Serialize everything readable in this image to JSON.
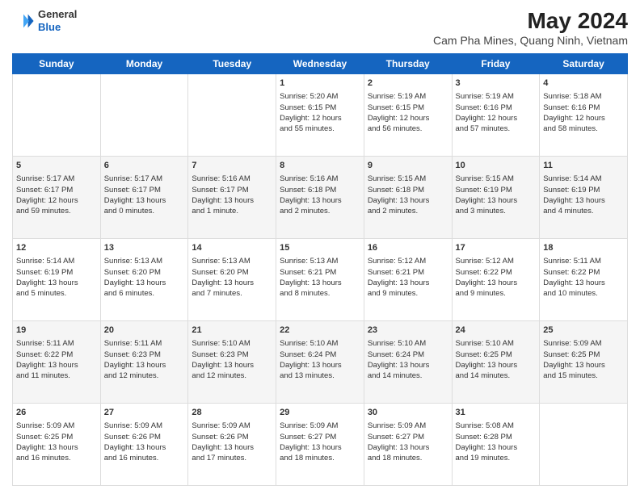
{
  "header": {
    "logo_line1": "General",
    "logo_line2": "Blue",
    "title": "May 2024",
    "subtitle": "Cam Pha Mines, Quang Ninh, Vietnam"
  },
  "weekdays": [
    "Sunday",
    "Monday",
    "Tuesday",
    "Wednesday",
    "Thursday",
    "Friday",
    "Saturday"
  ],
  "weeks": [
    [
      {
        "day": "",
        "info": ""
      },
      {
        "day": "",
        "info": ""
      },
      {
        "day": "",
        "info": ""
      },
      {
        "day": "1",
        "info": "Sunrise: 5:20 AM\nSunset: 6:15 PM\nDaylight: 12 hours\nand 55 minutes."
      },
      {
        "day": "2",
        "info": "Sunrise: 5:19 AM\nSunset: 6:15 PM\nDaylight: 12 hours\nand 56 minutes."
      },
      {
        "day": "3",
        "info": "Sunrise: 5:19 AM\nSunset: 6:16 PM\nDaylight: 12 hours\nand 57 minutes."
      },
      {
        "day": "4",
        "info": "Sunrise: 5:18 AM\nSunset: 6:16 PM\nDaylight: 12 hours\nand 58 minutes."
      }
    ],
    [
      {
        "day": "5",
        "info": "Sunrise: 5:17 AM\nSunset: 6:17 PM\nDaylight: 12 hours\nand 59 minutes."
      },
      {
        "day": "6",
        "info": "Sunrise: 5:17 AM\nSunset: 6:17 PM\nDaylight: 13 hours\nand 0 minutes."
      },
      {
        "day": "7",
        "info": "Sunrise: 5:16 AM\nSunset: 6:17 PM\nDaylight: 13 hours\nand 1 minute."
      },
      {
        "day": "8",
        "info": "Sunrise: 5:16 AM\nSunset: 6:18 PM\nDaylight: 13 hours\nand 2 minutes."
      },
      {
        "day": "9",
        "info": "Sunrise: 5:15 AM\nSunset: 6:18 PM\nDaylight: 13 hours\nand 2 minutes."
      },
      {
        "day": "10",
        "info": "Sunrise: 5:15 AM\nSunset: 6:19 PM\nDaylight: 13 hours\nand 3 minutes."
      },
      {
        "day": "11",
        "info": "Sunrise: 5:14 AM\nSunset: 6:19 PM\nDaylight: 13 hours\nand 4 minutes."
      }
    ],
    [
      {
        "day": "12",
        "info": "Sunrise: 5:14 AM\nSunset: 6:19 PM\nDaylight: 13 hours\nand 5 minutes."
      },
      {
        "day": "13",
        "info": "Sunrise: 5:13 AM\nSunset: 6:20 PM\nDaylight: 13 hours\nand 6 minutes."
      },
      {
        "day": "14",
        "info": "Sunrise: 5:13 AM\nSunset: 6:20 PM\nDaylight: 13 hours\nand 7 minutes."
      },
      {
        "day": "15",
        "info": "Sunrise: 5:13 AM\nSunset: 6:21 PM\nDaylight: 13 hours\nand 8 minutes."
      },
      {
        "day": "16",
        "info": "Sunrise: 5:12 AM\nSunset: 6:21 PM\nDaylight: 13 hours\nand 9 minutes."
      },
      {
        "day": "17",
        "info": "Sunrise: 5:12 AM\nSunset: 6:22 PM\nDaylight: 13 hours\nand 9 minutes."
      },
      {
        "day": "18",
        "info": "Sunrise: 5:11 AM\nSunset: 6:22 PM\nDaylight: 13 hours\nand 10 minutes."
      }
    ],
    [
      {
        "day": "19",
        "info": "Sunrise: 5:11 AM\nSunset: 6:22 PM\nDaylight: 13 hours\nand 11 minutes."
      },
      {
        "day": "20",
        "info": "Sunrise: 5:11 AM\nSunset: 6:23 PM\nDaylight: 13 hours\nand 12 minutes."
      },
      {
        "day": "21",
        "info": "Sunrise: 5:10 AM\nSunset: 6:23 PM\nDaylight: 13 hours\nand 12 minutes."
      },
      {
        "day": "22",
        "info": "Sunrise: 5:10 AM\nSunset: 6:24 PM\nDaylight: 13 hours\nand 13 minutes."
      },
      {
        "day": "23",
        "info": "Sunrise: 5:10 AM\nSunset: 6:24 PM\nDaylight: 13 hours\nand 14 minutes."
      },
      {
        "day": "24",
        "info": "Sunrise: 5:10 AM\nSunset: 6:25 PM\nDaylight: 13 hours\nand 14 minutes."
      },
      {
        "day": "25",
        "info": "Sunrise: 5:09 AM\nSunset: 6:25 PM\nDaylight: 13 hours\nand 15 minutes."
      }
    ],
    [
      {
        "day": "26",
        "info": "Sunrise: 5:09 AM\nSunset: 6:25 PM\nDaylight: 13 hours\nand 16 minutes."
      },
      {
        "day": "27",
        "info": "Sunrise: 5:09 AM\nSunset: 6:26 PM\nDaylight: 13 hours\nand 16 minutes."
      },
      {
        "day": "28",
        "info": "Sunrise: 5:09 AM\nSunset: 6:26 PM\nDaylight: 13 hours\nand 17 minutes."
      },
      {
        "day": "29",
        "info": "Sunrise: 5:09 AM\nSunset: 6:27 PM\nDaylight: 13 hours\nand 18 minutes."
      },
      {
        "day": "30",
        "info": "Sunrise: 5:09 AM\nSunset: 6:27 PM\nDaylight: 13 hours\nand 18 minutes."
      },
      {
        "day": "31",
        "info": "Sunrise: 5:08 AM\nSunset: 6:28 PM\nDaylight: 13 hours\nand 19 minutes."
      },
      {
        "day": "",
        "info": ""
      }
    ]
  ]
}
